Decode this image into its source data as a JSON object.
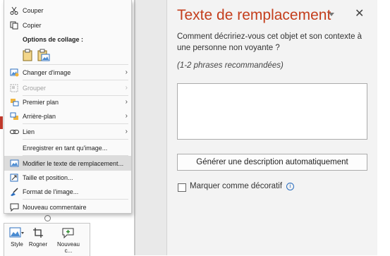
{
  "context_menu": {
    "cut": "Couper",
    "copy": "Copier",
    "paste_options": "Options de collage :",
    "change_image": "Changer d'image",
    "group": "Grouper",
    "bring_forward": "Premier plan",
    "send_backward": "Arrière-plan",
    "link": "Lien",
    "save_as_image": "Enregistrer en tant qu'image...",
    "edit_alt_text": "Modifier le texte de remplacement...",
    "size_position": "Taille et position...",
    "format_image": "Format de l'image...",
    "new_comment": "Nouveau commentaire"
  },
  "mini_toolbar": {
    "style": "Style",
    "crop": "Rogner",
    "new_line1": "Nouveau",
    "new_line2": "c..."
  },
  "alt_text_pane": {
    "title": "Texte de remplacement",
    "question": "Comment décririez-vous cet objet et son contexte à une personne non voyante ?",
    "hint": "(1-2 phrases recommandées)",
    "description_value": "",
    "generate_button": "Générer une description automatiquement",
    "decorative_label": "Marquer comme décoratif",
    "decorative_checked": false
  },
  "colors": {
    "accent": "#c43e1c",
    "pane_bg": "#f3f3f3",
    "hover": "#dcdcdc"
  }
}
